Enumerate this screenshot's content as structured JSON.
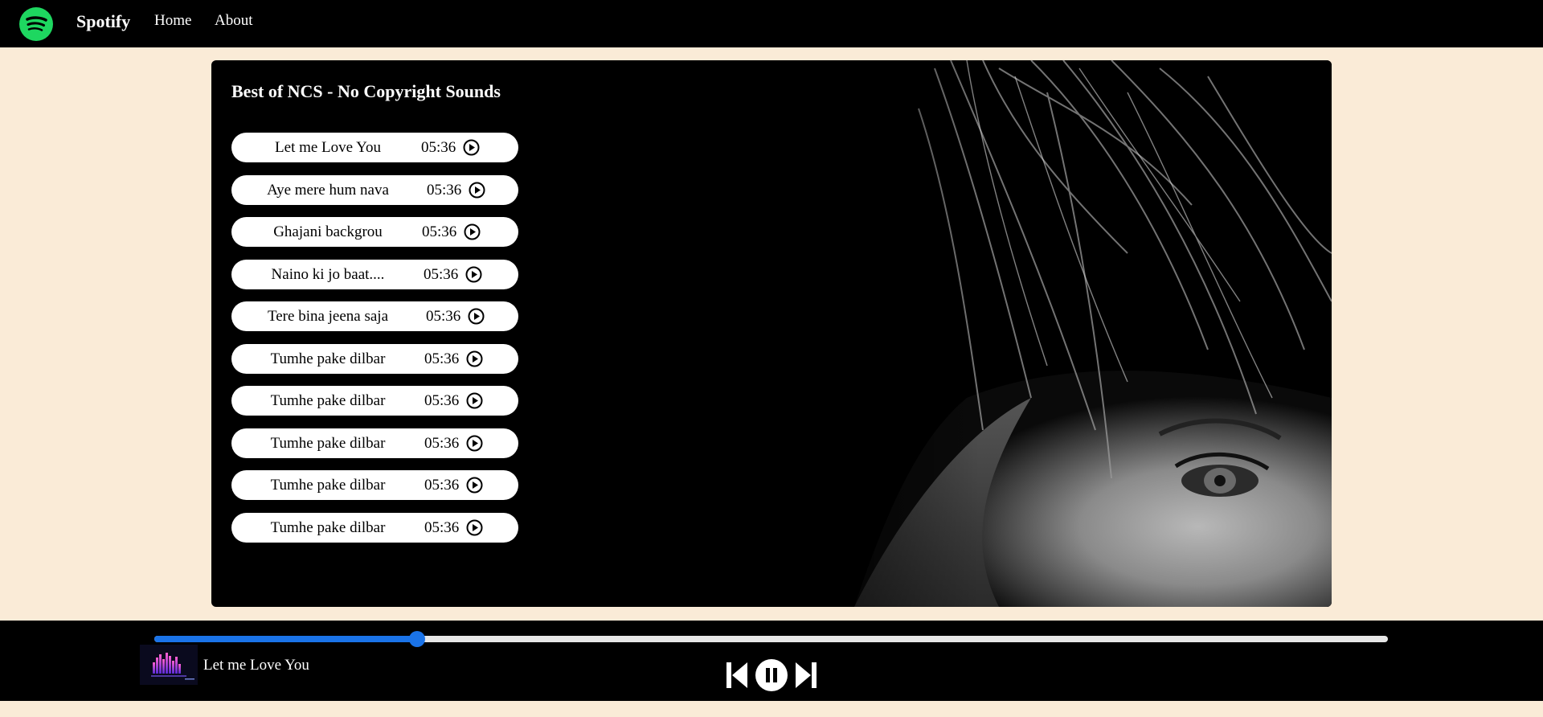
{
  "navbar": {
    "brand": "Spotify",
    "links": [
      "Home",
      "About"
    ],
    "logo_icon": "spotify-logo-icon",
    "logo_color": "#1ed760"
  },
  "playlist": {
    "title": "Best of NCS - No Copyright Sounds",
    "songs": [
      {
        "name": "Let me Love You",
        "duration": "05:36"
      },
      {
        "name": "Aye mere hum nava",
        "duration": "05:36"
      },
      {
        "name": "Ghajani backgrou",
        "duration": "05:36"
      },
      {
        "name": "Naino ki jo baat....",
        "duration": "05:36"
      },
      {
        "name": "Tere bina jeena saja",
        "duration": "05:36"
      },
      {
        "name": "Tumhe pake dilbar",
        "duration": "05:36"
      },
      {
        "name": "Tumhe pake dilbar",
        "duration": "05:36"
      },
      {
        "name": "Tumhe pake dilbar",
        "duration": "05:36"
      },
      {
        "name": "Tumhe pake dilbar",
        "duration": "05:36"
      },
      {
        "name": "Tumhe pake dilbar",
        "duration": "05:36"
      }
    ],
    "song_icon": "play-circle-icon"
  },
  "player": {
    "progress_fraction": 0.213,
    "now_playing": "Let me Love You",
    "controls": [
      "previous-icon",
      "pause-icon",
      "next-icon"
    ],
    "accent_color": "#1a73e8"
  },
  "colors": {
    "page_background": "#faebd7",
    "bar_background": "#000000"
  }
}
